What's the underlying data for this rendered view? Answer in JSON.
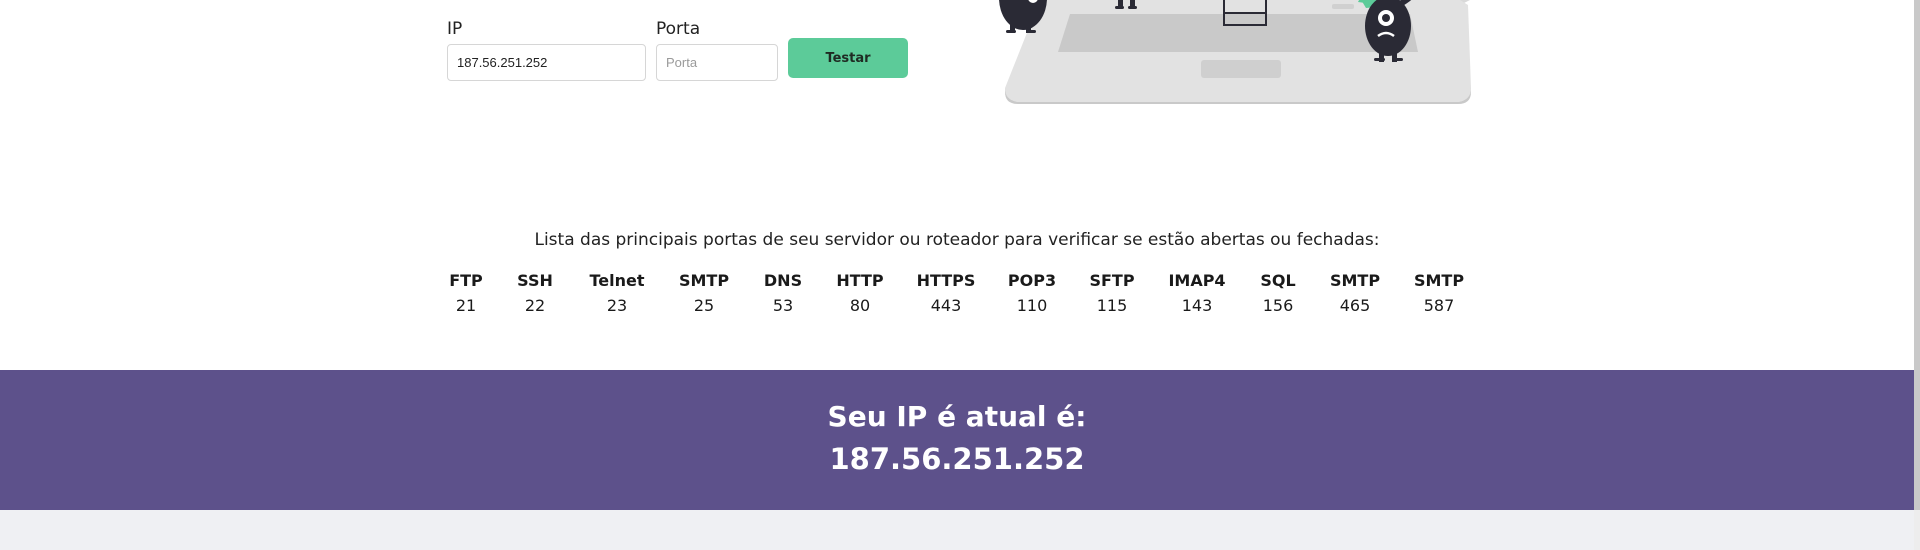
{
  "form": {
    "ip_label": "IP",
    "ip_value": "187.56.251.252",
    "port_label": "Porta",
    "port_placeholder": "Porta",
    "test_label": "Testar"
  },
  "ports": {
    "intro": "Lista das principais portas de seu servidor ou roteador para verificar se estão abertas ou fechadas:",
    "items": [
      {
        "name": "FTP",
        "port": "21"
      },
      {
        "name": "SSH",
        "port": "22"
      },
      {
        "name": "Telnet",
        "port": "23"
      },
      {
        "name": "SMTP",
        "port": "25"
      },
      {
        "name": "DNS",
        "port": "53"
      },
      {
        "name": "HTTP",
        "port": "80"
      },
      {
        "name": "HTTPS",
        "port": "443"
      },
      {
        "name": "POP3",
        "port": "110"
      },
      {
        "name": "SFTP",
        "port": "115"
      },
      {
        "name": "IMAP4",
        "port": "143"
      },
      {
        "name": "SQL",
        "port": "156"
      },
      {
        "name": "SMTP",
        "port": "465"
      },
      {
        "name": "SMTP",
        "port": "587"
      }
    ]
  },
  "banner": {
    "label": "Seu IP é atual é:",
    "ip": "187.56.251.252"
  },
  "colors": {
    "accent": "#5ccb99",
    "banner_bg": "#5d518b",
    "footer_bg": "#eff0f3"
  },
  "icons": {
    "illustration": "laptop-monsters-illustration"
  }
}
